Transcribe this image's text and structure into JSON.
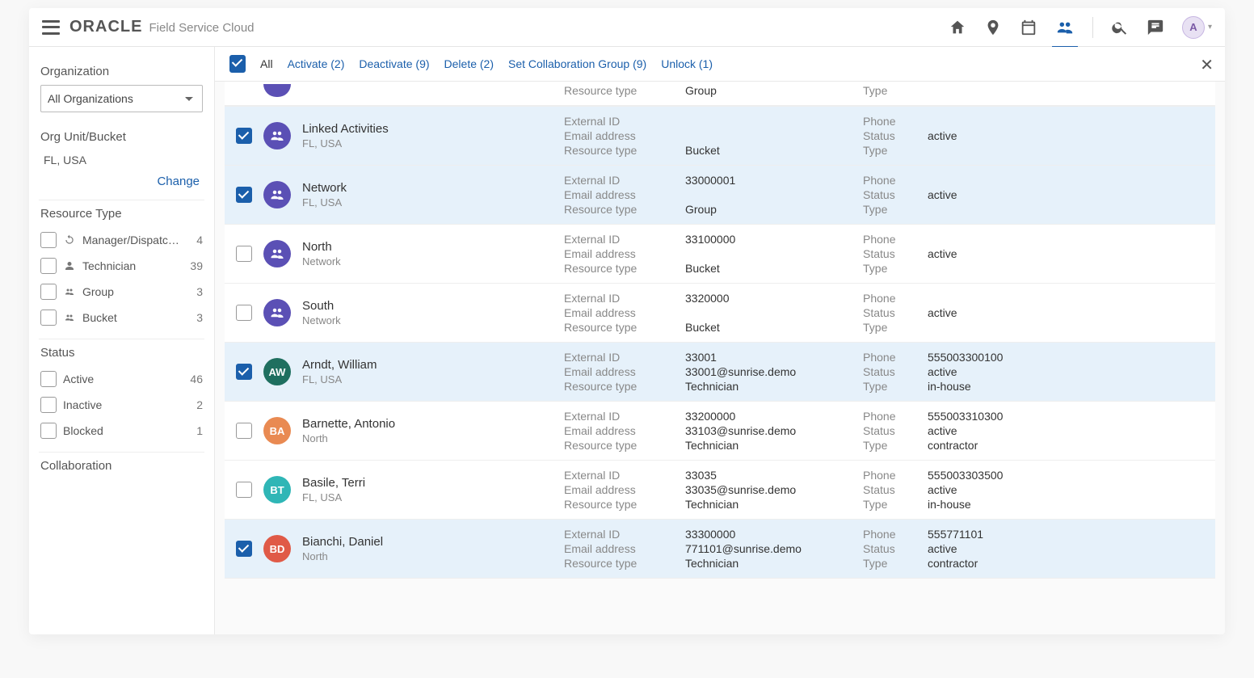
{
  "brand": {
    "logo": "ORACLE",
    "product": "Field Service Cloud"
  },
  "avatar_letter": "A",
  "sidebar": {
    "organization_label": "Organization",
    "organization_value": "All Organizations",
    "orgunit_label": "Org Unit/Bucket",
    "orgunit_value": "FL, USA",
    "change_link": "Change",
    "resource_type_label": "Resource Type",
    "resource_types": [
      {
        "label": "Manager/Dispatch…",
        "count": "4",
        "icon": "cycle"
      },
      {
        "label": "Technician",
        "count": "39",
        "icon": "person"
      },
      {
        "label": "Group",
        "count": "3",
        "icon": "group"
      },
      {
        "label": "Bucket",
        "count": "3",
        "icon": "group"
      }
    ],
    "status_label": "Status",
    "statuses": [
      {
        "label": "Active",
        "count": "46"
      },
      {
        "label": "Inactive",
        "count": "2"
      },
      {
        "label": "Blocked",
        "count": "1"
      }
    ],
    "collaboration_label": "Collaboration"
  },
  "action_bar": {
    "all": "All",
    "activate": "Activate (2)",
    "deactivate": "Deactivate (9)",
    "delete": "Delete (2)",
    "set_collab": "Set Collaboration Group (9)",
    "unlock": "Unlock (1)"
  },
  "field_labels": {
    "external_id": "External ID",
    "email": "Email address",
    "resource_type": "Resource type",
    "phone": "Phone",
    "status": "Status",
    "type": "Type"
  },
  "partial_top": {
    "resource_type_label": "Resource type",
    "resource_type_val": "Group",
    "type_label": "Type"
  },
  "rows": [
    {
      "checked": true,
      "avatar_kind": "icon",
      "avatar_class": "bg-purple",
      "name": "Linked Activities",
      "sub": "FL, USA",
      "external_id": "",
      "email": "",
      "resource_type": "Bucket",
      "phone": "",
      "status": "active",
      "type": ""
    },
    {
      "checked": true,
      "avatar_kind": "icon",
      "avatar_class": "bg-purple",
      "name": "Network",
      "sub": "FL, USA",
      "external_id": "33000001",
      "email": "",
      "resource_type": "Group",
      "phone": "",
      "status": "active",
      "type": ""
    },
    {
      "checked": false,
      "avatar_kind": "icon",
      "avatar_class": "bg-purple",
      "name": "North",
      "sub": "Network",
      "external_id": "33100000",
      "email": "",
      "resource_type": "Bucket",
      "phone": "",
      "status": "active",
      "type": ""
    },
    {
      "checked": false,
      "avatar_kind": "icon",
      "avatar_class": "bg-purple",
      "name": "South",
      "sub": "Network",
      "external_id": "3320000",
      "email": "",
      "resource_type": "Bucket",
      "phone": "",
      "status": "active",
      "type": ""
    },
    {
      "checked": true,
      "avatar_kind": "initials",
      "avatar_class": "bg-teal-d",
      "initials": "AW",
      "name": "Arndt, William",
      "sub": "FL, USA",
      "external_id": "33001",
      "email": "33001@sunrise.demo",
      "resource_type": "Technician",
      "phone": "555003300100",
      "status": "active",
      "type": "in-house"
    },
    {
      "checked": false,
      "avatar_kind": "initials",
      "avatar_class": "bg-orange",
      "initials": "BA",
      "name": "Barnette, Antonio",
      "sub": "North",
      "external_id": "33200000",
      "email": "33103@sunrise.demo",
      "resource_type": "Technician",
      "phone": "555003310300",
      "status": "active",
      "type": "contractor"
    },
    {
      "checked": false,
      "avatar_kind": "initials",
      "avatar_class": "bg-teal",
      "initials": "BT",
      "name": "Basile, Terri",
      "sub": "FL, USA",
      "external_id": "33035",
      "email": "33035@sunrise.demo",
      "resource_type": "Technician",
      "phone": "555003303500",
      "status": "active",
      "type": "in-house"
    },
    {
      "checked": true,
      "avatar_kind": "initials",
      "avatar_class": "bg-red",
      "initials": "BD",
      "name": "Bianchi, Daniel",
      "sub": "North",
      "external_id": "33300000",
      "email": "771101@sunrise.demo",
      "resource_type": "Technician",
      "phone": "555771101",
      "status": "active",
      "type": "contractor"
    }
  ]
}
